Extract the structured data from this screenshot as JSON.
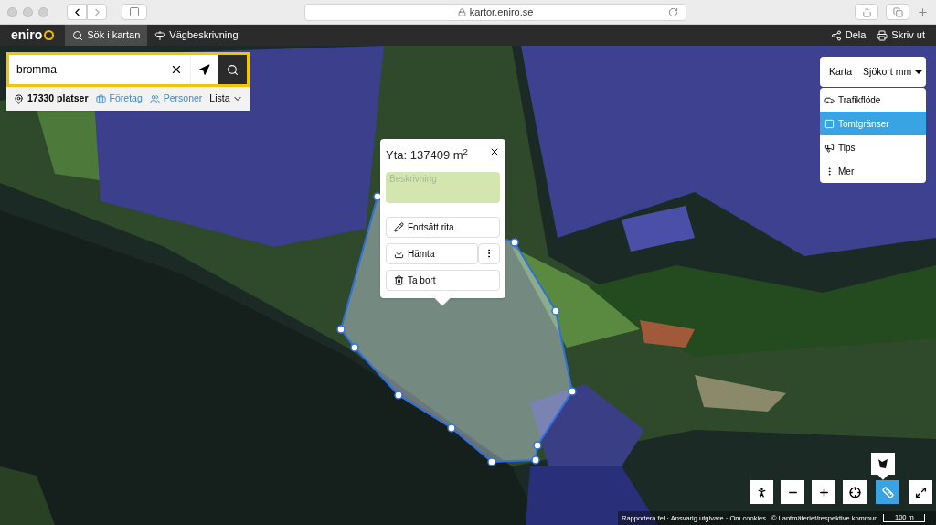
{
  "browser": {
    "url": "kartor.eniro.se"
  },
  "app_bar": {
    "logo": "eniro",
    "tabs": [
      {
        "label": "Sök i kartan",
        "selected": true
      },
      {
        "label": "Vägbeskrivning",
        "selected": false
      }
    ],
    "actions": [
      "Dela",
      "Skriv ut"
    ]
  },
  "search": {
    "value": "bromma",
    "count": "17330 platser",
    "filters": [
      "Företag",
      "Personer"
    ],
    "view": "Lista"
  },
  "popup": {
    "title": "Yta: 137409 m$^{2}$",
    "placeholder": "Beskrivning",
    "actions": [
      {
        "label": "Fortsätt rita",
        "kind": "plain"
      },
      {
        "label": "Hämta",
        "kind": "split"
      },
      {
        "label": "Ta bort",
        "kind": "plain"
      }
    ]
  },
  "layers": {
    "map_types": [
      "Karta",
      "Sjökort mm"
    ],
    "overlays": [
      {
        "label": "Trafikflöde",
        "selected": false
      },
      {
        "label": "Tomtgränser",
        "selected": true
      },
      {
        "label": "Tips",
        "selected": false
      },
      {
        "label": "Mer",
        "selected": false
      }
    ]
  },
  "controls": [
    {
      "selected": false
    },
    {
      "selected": false
    },
    {
      "selected": false
    },
    {
      "selected": false
    },
    {
      "selected": true
    },
    {
      "selected": false
    }
  ],
  "footer": {
    "links": "Rapportera fel · Ansvarig utgivare · Om cookies",
    "credit": "© Lantmäteriet/respektive kommun",
    "scale": "100 m"
  }
}
